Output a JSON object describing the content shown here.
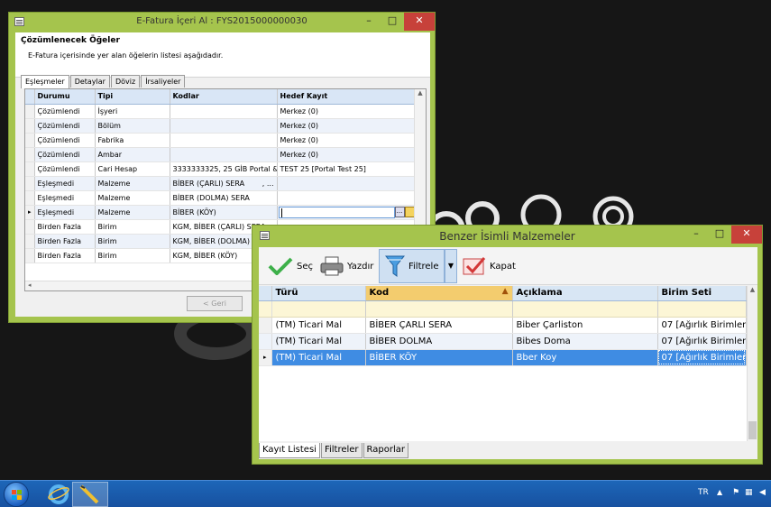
{
  "window1": {
    "title": "E-Fatura İçeri Al : FYS2015000000030",
    "header_title": "Çözümlenecek Öğeler",
    "header_subtitle": "E-Fatura içerisinde yer alan öğelerin listesi aşağıdadır.",
    "tabs": [
      "Eşleşmeler",
      "Detaylar",
      "Döviz",
      "İrsaliyeler"
    ],
    "columns": [
      "Durumu",
      "Tipi",
      "Kodlar",
      "Hedef Kayıt"
    ],
    "rows": [
      [
        "Çözümlendi",
        "İşyeri",
        "",
        "Merkez (0)"
      ],
      [
        "Çözümlendi",
        "Bölüm",
        "",
        "Merkez (0)"
      ],
      [
        "Çözümlendi",
        "Fabrika",
        "",
        "Merkez (0)"
      ],
      [
        "Çözümlendi",
        "Ambar",
        "",
        "Merkez (0)"
      ],
      [
        "Çözümlendi",
        "Cari Hesap",
        "3333333325, 25 GİB Portal & ...",
        "TEST 25 [Portal Test 25]"
      ],
      [
        "Eşleşmedi",
        "Malzeme",
        "BİBER (ÇARLI) SERA",
        ""
      ],
      [
        "Eşleşmedi",
        "Malzeme",
        "BİBER (DOLMA) SERA",
        ""
      ],
      [
        "Eşleşmedi",
        "Malzeme",
        "BİBER (KÖY)",
        ""
      ],
      [
        "Birden Fazla",
        "Birim",
        "KGM, BİBER (ÇARLI) SERA",
        ""
      ],
      [
        "Birden Fazla",
        "Birim",
        "KGM, BİBER (DOLMA) SERA",
        ""
      ],
      [
        "Birden Fazla",
        "Birim",
        "KGM, BİBER (KÖY)",
        ""
      ]
    ],
    "ellipsis_tag": ", ...",
    "lookup_button": "...",
    "back_button": "< Geri"
  },
  "window2": {
    "title": "Benzer İsimli Malzemeler",
    "toolbar": {
      "select_label": "Seç",
      "print_label": "Yazdır",
      "filter_label": "Filtrele",
      "close_label": "Kapat"
    },
    "columns": [
      "Türü",
      "Kod",
      "Açıklama",
      "Birim Seti"
    ],
    "rows": [
      [
        "(TM) Ticari Mal",
        "BİBER ÇARLI SERA",
        "Biber Çarliston",
        "07 [Ağırlık Birimleri]"
      ],
      [
        "(TM) Ticari Mal",
        "BİBER DOLMA",
        "Bibes Doma",
        "07 [Ağırlık Birimleri]"
      ],
      [
        "(TM) Ticari Mal",
        "BİBER KÖY",
        "Bber Koy",
        "07 [Ağırlık Birimleri]"
      ]
    ],
    "bottom_tabs": [
      "Kayıt Listesi",
      "Filtreler",
      "Raporlar"
    ]
  },
  "taskbar": {
    "language": "TR"
  },
  "colors": {
    "window_frame": "#a5c44d",
    "selected_row": "#3f8ce3",
    "sorted_header": "#f3cc6e",
    "close_button": "#c7413a"
  }
}
